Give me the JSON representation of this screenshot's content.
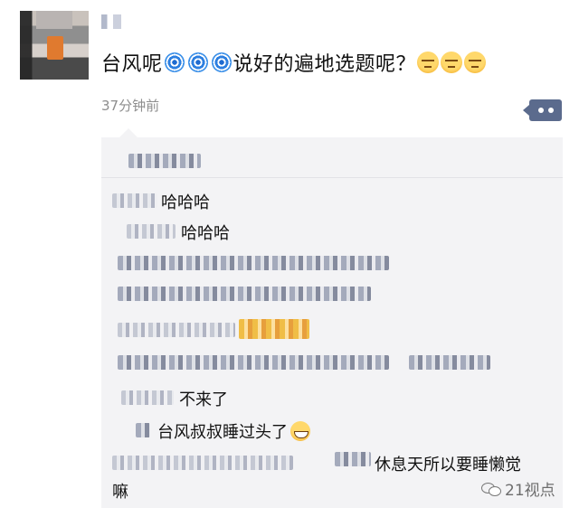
{
  "post": {
    "text_before": "台风呢",
    "text_after": "说好的遍地选题呢？",
    "timestamp": "37分钟前",
    "icons": {
      "cyclone": "cyclone-emoji-icon",
      "unamused": "unamused-face-emoji-icon",
      "comment": "comment-bubble-icon"
    }
  },
  "comments": {
    "c1_text": "哈哈哈",
    "c2_text": "哈哈哈",
    "c7_text": "不来了",
    "c8_text": "台风叔叔睡过头了",
    "c9_text_line1": "休息天所以要睡懒觉",
    "c9_text_line2": "嘛"
  },
  "watermark": {
    "text": "21视点",
    "icon": "wechat-icon"
  },
  "colors": {
    "comment_button": "#5b6b8d",
    "panel_bg": "#f3f3f5",
    "timestamp": "#8e8e8e"
  }
}
